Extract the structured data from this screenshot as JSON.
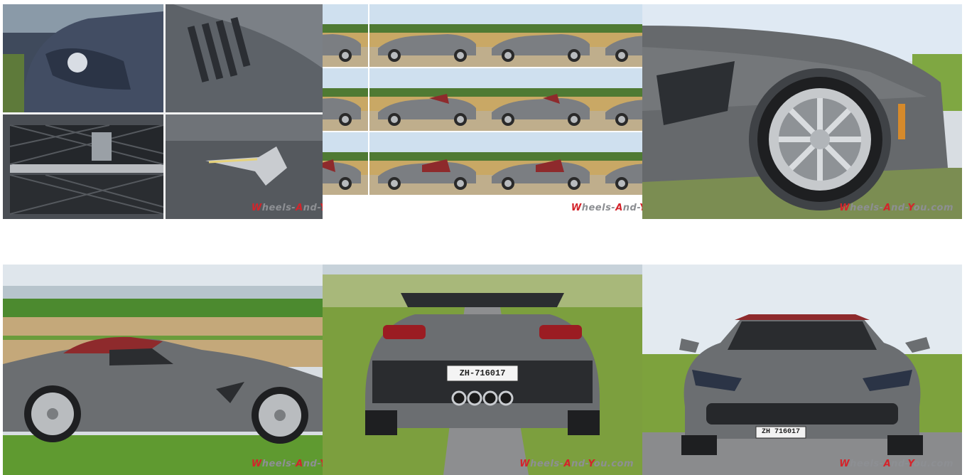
{
  "gallery": {
    "watermark": {
      "w": "W",
      "heels": "heels-",
      "a": "A",
      "nd": "nd-",
      "y": "Y",
      "ou": "ou.com",
      "full": "Wheels-And-You.com",
      "cut": "Wheels-And-",
      "cut_tile2": "Wheels-And-Y"
    },
    "plates": {
      "rear": "ZH-716017",
      "front": "ZH 716017"
    },
    "colors": {
      "car_gray": "#6b6e71",
      "soft_top_red": "#8e2a2c",
      "sky": "#dfe7ef",
      "grass": "#6f9b3a",
      "road": "#8a8b8d",
      "watermark_red": "#d4242b"
    }
  }
}
